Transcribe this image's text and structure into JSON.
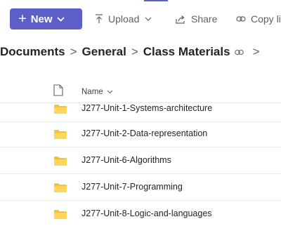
{
  "toolbar": {
    "new_label": "New",
    "upload_label": "Upload",
    "share_label": "Share",
    "copy_link_label": "Copy lin"
  },
  "breadcrumb": {
    "items": [
      "Documents",
      "General",
      "Class Materials"
    ],
    "separator": ">"
  },
  "list": {
    "name_header": "Name",
    "rows": [
      {
        "name": "J277-Unit-1-Systems-architecture",
        "icon": "folder-icon"
      },
      {
        "name": "J277-Unit-2-Data-representation",
        "icon": "folder-icon"
      },
      {
        "name": "J277-Unit-6-Algorithms",
        "icon": "folder-icon"
      },
      {
        "name": "J277-Unit-7-Programming",
        "icon": "folder-icon"
      },
      {
        "name": "J277-Unit-8-Logic-and-languages",
        "icon": "folder-icon"
      }
    ]
  },
  "colors": {
    "accent": "#5b5fc7",
    "folder": "#f5c227",
    "text": "#242424",
    "muted": "#616161"
  }
}
